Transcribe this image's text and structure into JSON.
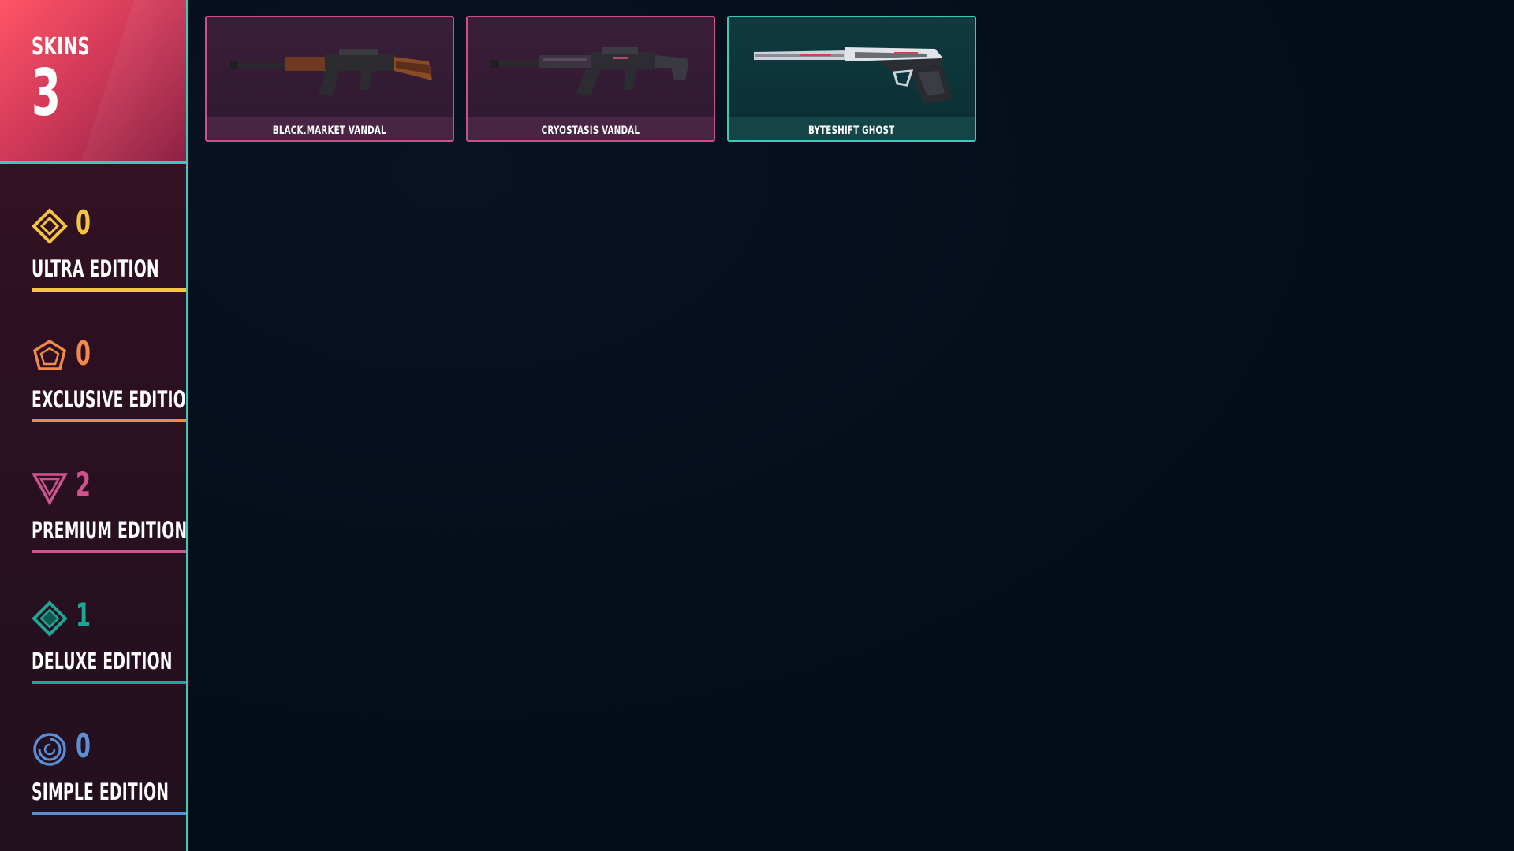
{
  "summary": {
    "label": "SKINS",
    "count": "3"
  },
  "editions": [
    {
      "label": "ULTRA EDITION",
      "count": "0",
      "color": "#f5c542",
      "icon": "ultra-edition-icon"
    },
    {
      "label": "EXCLUSIVE EDITION",
      "count": "0",
      "color": "#f08a4b",
      "icon": "exclusive-edition-icon"
    },
    {
      "label": "PREMIUM EDITION",
      "count": "2",
      "color": "#d1538e",
      "icon": "premium-edition-icon"
    },
    {
      "label": "DELUXE EDITION",
      "count": "1",
      "color": "#1fa596",
      "icon": "deluxe-edition-icon"
    },
    {
      "label": "SIMPLE EDITION",
      "count": "0",
      "color": "#5a8fd6",
      "icon": "simple-edition-icon"
    }
  ],
  "skins": [
    {
      "name": "BLACK.MARKET VANDAL",
      "edition": "premium",
      "icon": "rifle-icon"
    },
    {
      "name": "CRYOSTASIS VANDAL",
      "edition": "premium",
      "icon": "rifle-icon"
    },
    {
      "name": "BYTESHIFT GHOST",
      "edition": "deluxe",
      "icon": "pistol-icon"
    }
  ],
  "colors": {
    "accent_teal": "#3cc9b8",
    "premium_border": "#c8518a",
    "background": "#050c19"
  }
}
